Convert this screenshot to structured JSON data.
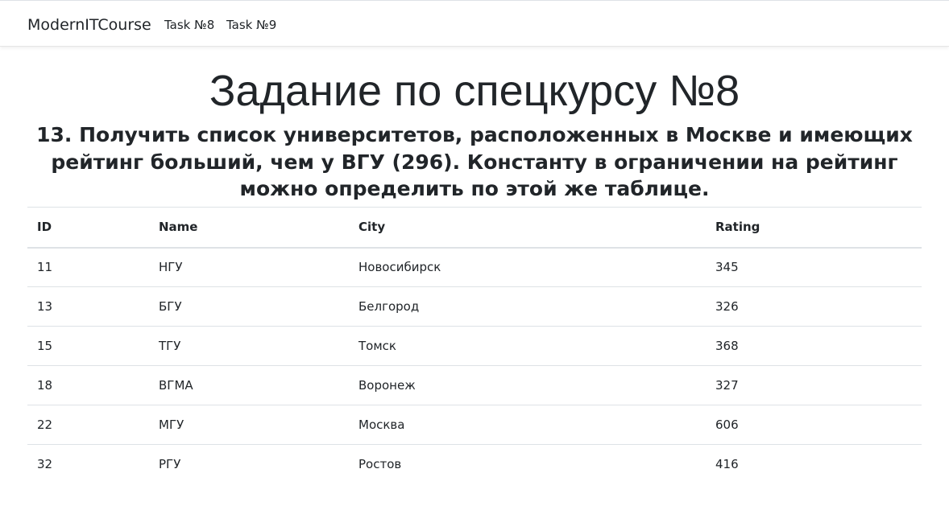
{
  "navbar": {
    "brand": "ModernITCourse",
    "links": [
      "Task №8",
      "Task №9"
    ]
  },
  "page": {
    "title": "Задание по спецкурсу №8",
    "task": "13. Получить список университетов, расположенных в Москве и имеющих рейтинг больший, чем у ВГУ (296). Константу в ограничении на рейтинг можно определить по этой же таблице."
  },
  "table": {
    "headers": [
      "ID",
      "Name",
      "City",
      "Rating"
    ],
    "rows": [
      [
        "11",
        "НГУ",
        "Новосибирск",
        "345"
      ],
      [
        "13",
        "БГУ",
        "Белгород",
        "326"
      ],
      [
        "15",
        "ТГУ",
        "Томск",
        "368"
      ],
      [
        "18",
        "ВГМА",
        "Воронеж",
        "327"
      ],
      [
        "22",
        "МГУ",
        "Москва",
        "606"
      ],
      [
        "32",
        "РГУ",
        "Ростов",
        "416"
      ]
    ]
  }
}
